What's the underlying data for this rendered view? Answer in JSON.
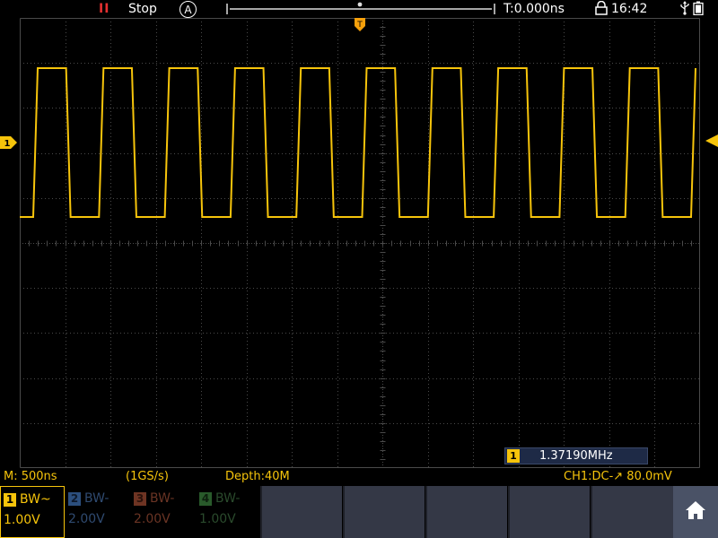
{
  "topbar": {
    "run_indicator": "II",
    "run_status": "Stop",
    "auto_label": "A",
    "time_offset": "T:0.000ns",
    "clock": "16:42"
  },
  "markers": {
    "channel_marker_label": "1",
    "trigger_position_label": "T"
  },
  "measurement": {
    "channel": "1",
    "value": "1.37190MHz"
  },
  "infoline": {
    "timebase": "M: 500ns",
    "sample_rate": "(1GS/s)",
    "depth": "Depth:40M",
    "trigger": "CH1:DC-↗ 80.0mV"
  },
  "channels": [
    {
      "num": "1",
      "bw": "BW~",
      "volts": "1.00V"
    },
    {
      "num": "2",
      "bw": "BW-",
      "volts": "2.00V"
    },
    {
      "num": "3",
      "bw": "BW-",
      "volts": "2.00V"
    },
    {
      "num": "4",
      "bw": "BW-",
      "volts": "1.00V"
    }
  ],
  "colors": {
    "ch1": "#f6c40b",
    "ch2": "#2c4f7e",
    "ch3": "#6e3423",
    "ch4": "#295a2b",
    "run_stop": "#e53030",
    "grid": "#4a4a4a"
  },
  "icons": {
    "lock": "lock-icon",
    "usb": "usb-icon",
    "battery": "battery-icon",
    "home": "home-icon"
  },
  "waveform": {
    "channel": "1",
    "shape": "square",
    "cycles_visible": 11,
    "duty_cycle": 0.5
  }
}
